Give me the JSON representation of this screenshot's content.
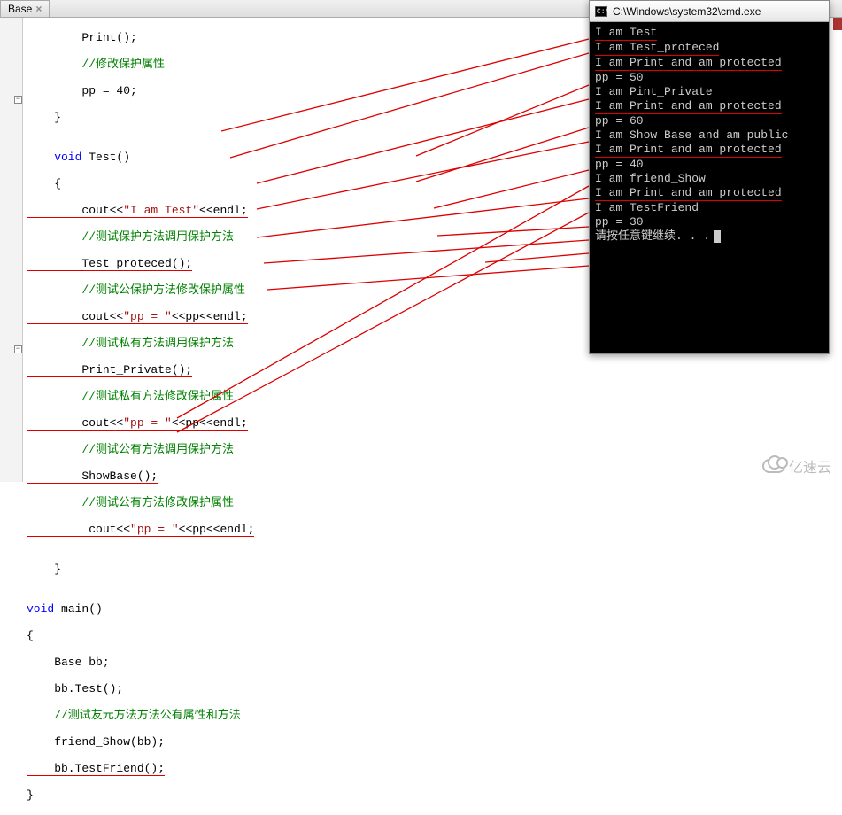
{
  "ide": {
    "tab_title": "Base",
    "fold_minus": "−"
  },
  "code": {
    "l1": "        Print();",
    "l2": "        //修改保护属性",
    "l3": "        pp = 40;",
    "l4": "    }",
    "l5": "",
    "l6": "    void Test()",
    "l7": "    {",
    "l8a": "        cout<<",
    "l8s": "\"I am Test\"",
    "l8b": "<<endl;",
    "l9": "        //测试保护方法调用保护方法",
    "l10": "        Test_proteced();",
    "l11": "        //测试公保护方法修改保护属性",
    "l12a": "        cout<<",
    "l12s": "\"pp = \"",
    "l12b": "<<pp<<endl;",
    "l13": "        //测试私有方法调用保护方法",
    "l14": "        Print_Private();",
    "l15": "        //测试私有方法修改保护属性",
    "l16a": "        cout<<",
    "l16s": "\"pp = \"",
    "l16b": "<<pp<<endl;",
    "l17": "        //测试公有方法调用保护方法",
    "l18": "        ShowBase();",
    "l19": "        //测试公有方法修改保护属性",
    "l20a": "         cout<<",
    "l20s": "\"pp = \"",
    "l20b": "<<pp<<endl;",
    "l21": "",
    "l22": "    }",
    "l23": "",
    "l24a": "void",
    "l24b": " main()",
    "l25": "{",
    "l26": "    Base bb;",
    "l27": "    bb.Test();",
    "l28": "    //测试友元方法方法公有属性和方法",
    "l29": "    friend_Show(bb);",
    "l30": "    bb.TestFriend();",
    "l31": "}"
  },
  "console": {
    "title": "C:\\Windows\\system32\\cmd.exe",
    "lines": [
      {
        "text": "I am Test",
        "ul": true
      },
      {
        "text": "I am Test_proteced",
        "ul": true
      },
      {
        "text": "I am Print and am protected",
        "ul": true
      },
      {
        "text": "pp = 50",
        "ul": false
      },
      {
        "text": "I am Pint_Private",
        "ul": false
      },
      {
        "text": "I am Print and am protected",
        "ul": true
      },
      {
        "text": "pp = 60",
        "ul": false
      },
      {
        "text": "I am Show Base and am public",
        "ul": false
      },
      {
        "text": "I am Print and am protected",
        "ul": true
      },
      {
        "text": "pp = 40",
        "ul": false
      },
      {
        "text": "I am friend_Show",
        "ul": false
      },
      {
        "text": "I am Print and am protected",
        "ul": true
      },
      {
        "text": "I am TestFriend",
        "ul": false
      },
      {
        "text": "pp = 30",
        "ul": false
      },
      {
        "text": "请按任意键继续. . .",
        "ul": false,
        "cursor": true
      }
    ]
  },
  "watermark": "亿速云"
}
